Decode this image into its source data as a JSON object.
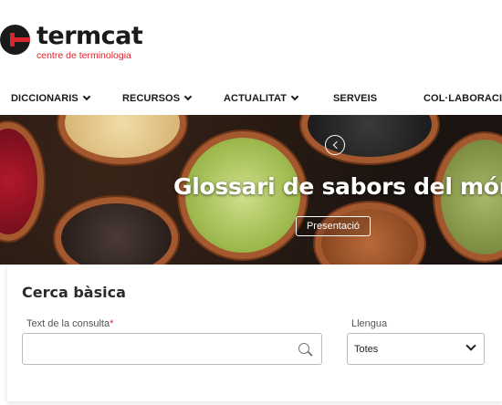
{
  "brand": {
    "name": "termcat",
    "tagline": "centre de terminologia"
  },
  "nav": {
    "items": [
      {
        "label": "DICCIONARIS",
        "has_dropdown": true
      },
      {
        "label": "RECURSOS",
        "has_dropdown": true
      },
      {
        "label": "ACTUALITAT",
        "has_dropdown": true
      },
      {
        "label": "SERVEIS",
        "has_dropdown": false
      },
      {
        "label": "COL·LABORACIÓ",
        "has_dropdown": false
      }
    ]
  },
  "hero": {
    "title": "Glossari de sabors del món",
    "button_label": "Presentació",
    "prev_icon": "chevron-left-circle-icon"
  },
  "search": {
    "title": "Cerca bàsica",
    "query_label": "Text de la consulta",
    "required_mark": "*",
    "query_value": "",
    "language_label": "Llengua",
    "language_value": "Totes"
  },
  "colors": {
    "brand_red": "#d8262f",
    "brand_dark": "#1a1a1a"
  }
}
